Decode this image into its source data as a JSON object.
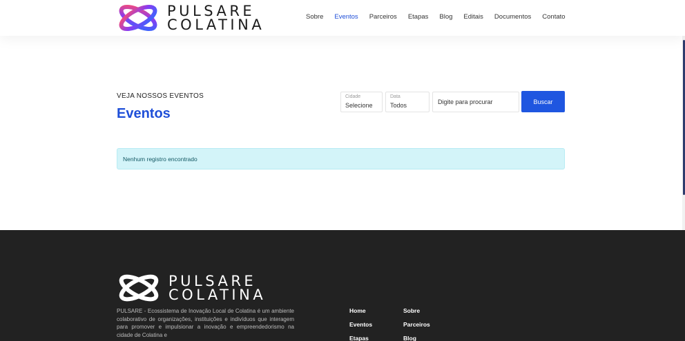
{
  "brand": {
    "line1": "PULSARE",
    "line2": "COLATINA"
  },
  "nav": [
    {
      "label": "Sobre",
      "active": false
    },
    {
      "label": "Eventos",
      "active": true
    },
    {
      "label": "Parceiros",
      "active": false
    },
    {
      "label": "Etapas",
      "active": false
    },
    {
      "label": "Blog",
      "active": false
    },
    {
      "label": "Editais",
      "active": false
    },
    {
      "label": "Documentos",
      "active": false
    },
    {
      "label": "Contato",
      "active": false
    }
  ],
  "main": {
    "eyebrow": "VEJA NOSSOS EVENTOS",
    "title": "Eventos",
    "filters": {
      "cidade": {
        "label": "Cidade",
        "value": "Selecione"
      },
      "data": {
        "label": "Data",
        "value": "Todos"
      }
    },
    "search": {
      "placeholder": "Digite para procurar",
      "value": ""
    },
    "button": "Buscar",
    "empty_message": "Nenhum registro encontrado"
  },
  "footer": {
    "description": "PULSARE - Ecossistema de Inovação Local de Colatina é um ambiente colaborativo de organizações, instituições e indivíduos que interagem para promover e impulsionar a inovação e empreendedorismo na cidade de Colatina e",
    "links_col1": [
      "Home",
      "Eventos",
      "Etapas"
    ],
    "links_col2": [
      "Sobre",
      "Parceiros",
      "Blog"
    ]
  },
  "colors": {
    "accent": "#1f4fd8",
    "footer_bg": "#222222",
    "alert_bg": "#d3f4f9"
  }
}
